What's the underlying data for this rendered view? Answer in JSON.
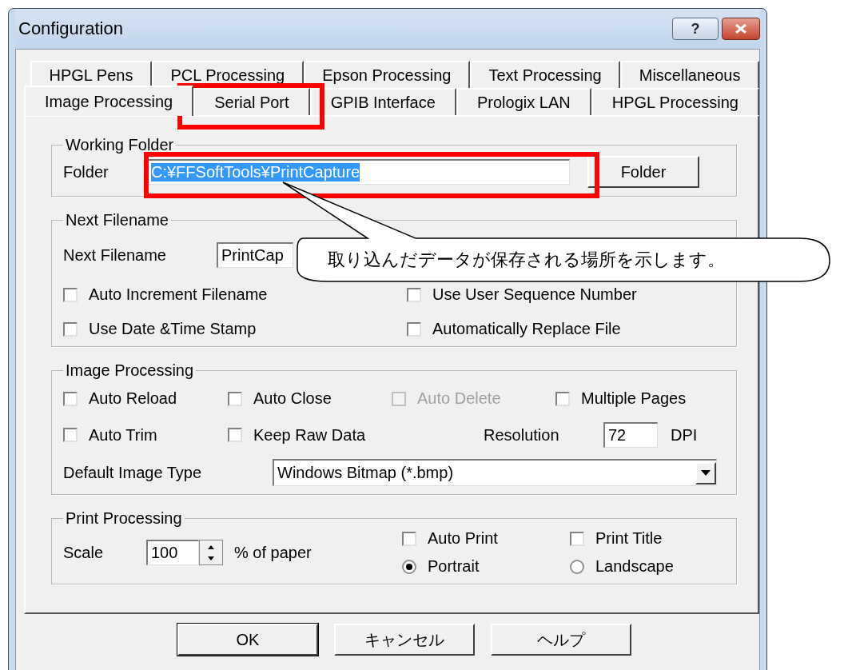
{
  "window": {
    "title": "Configuration",
    "help_label": "?"
  },
  "tab_rows": [
    [
      {
        "label": "HPGL Pens",
        "selected": false
      },
      {
        "label": "PCL Processing",
        "selected": false
      },
      {
        "label": "Epson Processing",
        "selected": false
      },
      {
        "label": "Text Processing",
        "selected": false
      },
      {
        "label": "Miscellaneous",
        "selected": false
      }
    ],
    [
      {
        "label": "Image Processing",
        "selected": true
      },
      {
        "label": "Serial Port",
        "selected": false
      },
      {
        "label": "GPIB Interface",
        "selected": false
      },
      {
        "label": "Prologix LAN",
        "selected": false
      },
      {
        "label": "HPGL Processing",
        "selected": false
      }
    ]
  ],
  "working_folder": {
    "title": "Working Folder",
    "label": "Folder",
    "value": "C:¥FFSoftTools¥PrintCapture",
    "text_selected": true,
    "button": "Folder"
  },
  "next_filename": {
    "title": "Next Filename",
    "label": "Next Filename",
    "value": "PrintCap",
    "checkboxes": [
      {
        "label": "Auto Increment Filename",
        "checked": false,
        "disabled": false
      },
      {
        "label": "Use User Sequence Number",
        "checked": false,
        "disabled": false
      },
      {
        "label": "Use Date &Time Stamp",
        "checked": false,
        "disabled": false
      },
      {
        "label": "Automatically Replace File",
        "checked": false,
        "disabled": false
      }
    ]
  },
  "image_processing": {
    "title": "Image Processing",
    "checkboxes": [
      {
        "label": "Auto Reload",
        "checked": false,
        "disabled": false
      },
      {
        "label": "Auto Close",
        "checked": false,
        "disabled": false
      },
      {
        "label": "Auto Delete",
        "checked": false,
        "disabled": true
      },
      {
        "label": "Multiple Pages",
        "checked": false,
        "disabled": false
      },
      {
        "label": "Auto Trim",
        "checked": false,
        "disabled": false
      },
      {
        "label": "Keep Raw Data",
        "checked": false,
        "disabled": false
      }
    ],
    "resolution": {
      "label": "Resolution",
      "value": "72",
      "unit": "DPI"
    },
    "default_image_type": {
      "label": "Default Image Type",
      "value": "Windows Bitmap (*.bmp)"
    }
  },
  "print_processing": {
    "title": "Print Processing",
    "scale": {
      "label": "Scale",
      "value": "100",
      "unit": "% of paper"
    },
    "checkboxes": [
      {
        "label": "Auto Print",
        "checked": false,
        "disabled": false
      },
      {
        "label": "Print Title",
        "checked": false,
        "disabled": false
      }
    ],
    "radios": [
      {
        "label": "Portrait",
        "selected": true
      },
      {
        "label": "Landscape",
        "selected": false
      }
    ]
  },
  "buttons": [
    "OK",
    "キャンセル",
    "ヘルプ"
  ],
  "callout": "取り込んだデータが保存される場所を示します。"
}
